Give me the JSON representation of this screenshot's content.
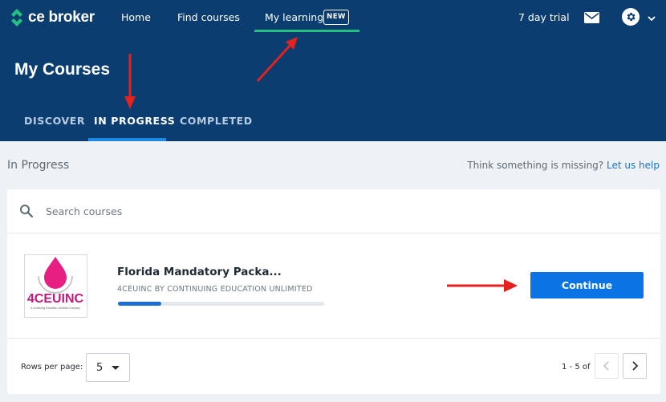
{
  "brand": {
    "name": "ce broker",
    "accent": "#22c17f",
    "header_bg": "#0b3d70",
    "primary_button": "#0b73e3"
  },
  "topnav": {
    "items": [
      {
        "label": "Home",
        "icon": ""
      },
      {
        "label": "Find courses",
        "icon": ""
      },
      {
        "label": "My learning",
        "icon": "",
        "badge": "NEW",
        "active": true
      }
    ],
    "trial_label": "7 day trial",
    "mail_icon": "mail-icon",
    "settings_icon": "gear-icon",
    "menu_icon": "chevron-down-icon"
  },
  "page": {
    "title": "My Courses",
    "tabs": [
      {
        "label": "DISCOVER",
        "active": false
      },
      {
        "label": "IN PROGRESS",
        "active": true
      },
      {
        "label": "COMPLETED",
        "active": false
      }
    ]
  },
  "content": {
    "section_title": "In Progress",
    "missing_text": "Think something is missing?",
    "help_link": "Let us help",
    "search": {
      "placeholder": "Search courses",
      "value": "",
      "icon": "search-icon"
    },
    "courses": [
      {
        "title": "Florida Mandatory Packa...",
        "provider": "4CEUINC BY CONTINUING EDUCATION UNLIMITED",
        "progress_fraction": 0.21,
        "action_label": "Continue",
        "logo": {
          "text_main": "4CEUINC",
          "text_sub": "A Continuing Education Unlimited Company"
        }
      }
    ],
    "pagination": {
      "rows_label": "Rows per page:",
      "rows_value": "5",
      "range_text": "1 - 5 of",
      "prev_icon": "chevron-left-icon",
      "next_icon": "chevron-right-icon"
    }
  },
  "annotations": {
    "arrow_color": "#e3211f"
  }
}
